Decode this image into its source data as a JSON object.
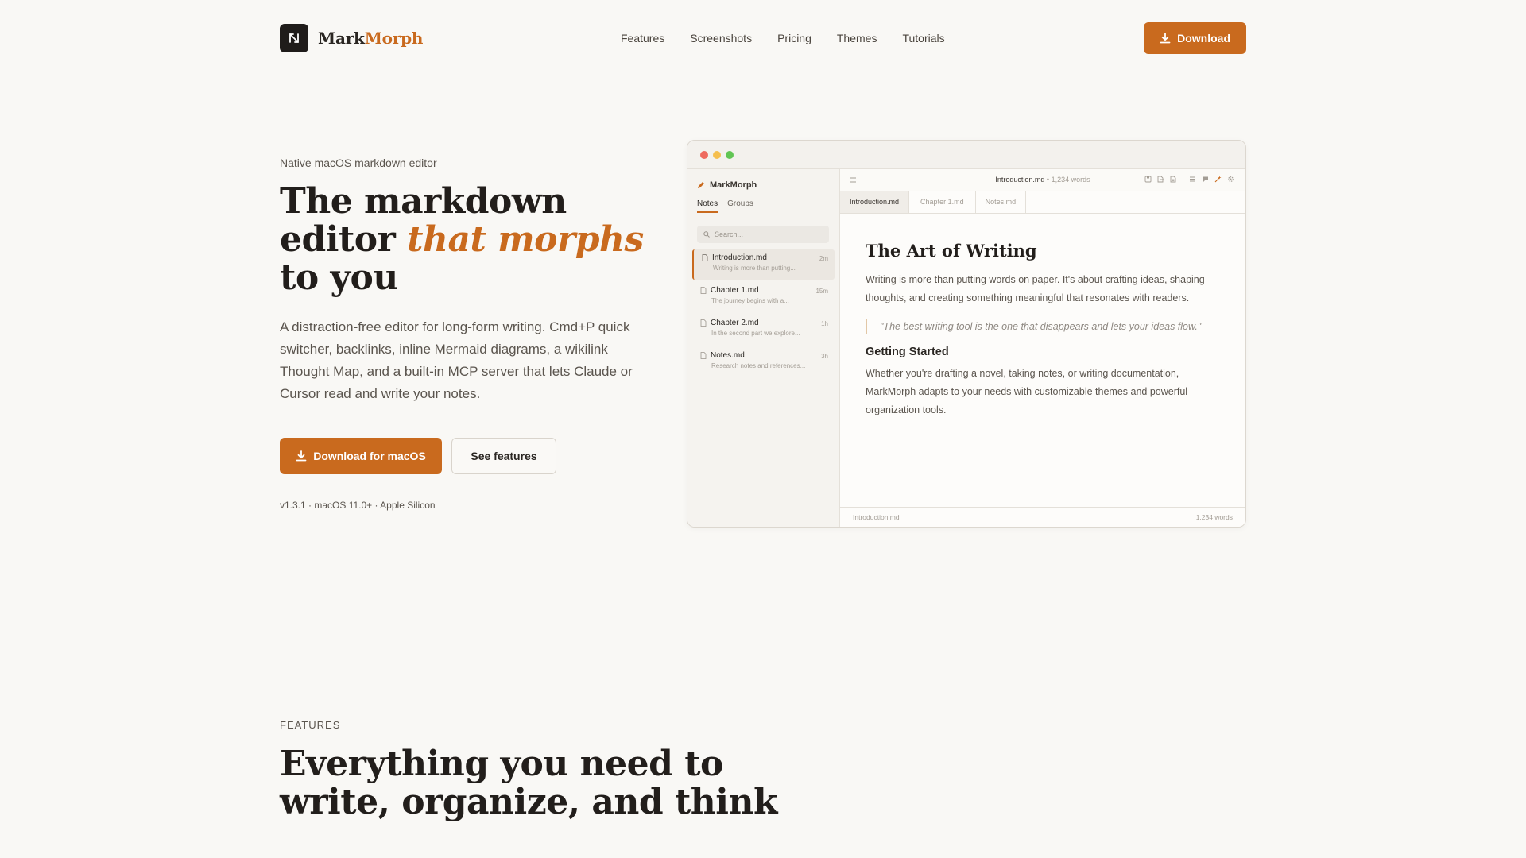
{
  "nav": {
    "brand_part1": "Mark",
    "brand_part2": "Morph",
    "links": [
      "Features",
      "Screenshots",
      "Pricing",
      "Themes",
      "Tutorials"
    ],
    "download_label": "Download"
  },
  "hero": {
    "eyebrow": "Native macOS markdown editor",
    "title_part1": "The markdown editor ",
    "title_accent": "that morphs",
    "title_part2": " to you",
    "description": "A distraction-free editor for long-form writing. Cmd+P quick switcher, backlinks, inline Mermaid diagrams, a wikilink Thought Map, and a built-in MCP server that lets Claude or Cursor read and write your notes.",
    "primary_cta": "Download for macOS",
    "secondary_cta": "See features",
    "version_info": "v1.3.1 · macOS 11.0+ · Apple Silicon"
  },
  "app": {
    "brand": "MarkMorph",
    "sidebar_tabs": [
      "Notes",
      "Groups"
    ],
    "search_placeholder": "Search...",
    "files": [
      {
        "name": "Introduction.md",
        "preview": "Writing is more than putting...",
        "time": "2m",
        "active": true
      },
      {
        "name": "Chapter 1.md",
        "preview": "The journey begins with a...",
        "time": "15m",
        "active": false
      },
      {
        "name": "Chapter 2.md",
        "preview": "In the second part we explore...",
        "time": "1h",
        "active": false
      },
      {
        "name": "Notes.md",
        "preview": "Research notes and references...",
        "time": "3h",
        "active": false
      }
    ],
    "toolbar_filename": "Introduction.md",
    "toolbar_separator": "•",
    "toolbar_wordcount": "1,234 words",
    "tabs": [
      "Introduction.md",
      "Chapter 1.md",
      "Notes.md"
    ],
    "doc": {
      "heading": "The Art of Writing",
      "para1": "Writing is more than putting words on paper. It's about crafting ideas, shaping thoughts, and creating something meaningful that resonates with readers.",
      "quote": "\"The best writing tool is the one that disappears and lets your ideas flow.\"",
      "subheading": "Getting Started",
      "para2": "Whether you're drafting a novel, taking notes, or writing documentation, MarkMorph adapts to your needs with customizable themes and powerful organization tools."
    },
    "status_left": "Introduction.md",
    "status_right": "1,234 words"
  },
  "features": {
    "label": "FEATURES",
    "title": "Everything you need to write, organize, and think"
  },
  "colors": {
    "accent": "#c96a1e",
    "background": "#f9f8f5",
    "text": "#221e1b",
    "traffic_red": "#ee6a5f",
    "traffic_yellow": "#f5bf4f",
    "traffic_green": "#61c554"
  },
  "icons": [
    "logo-icon",
    "download-icon",
    "pencil-icon",
    "search-icon",
    "file-icon",
    "menu-icon",
    "save-icon",
    "export-icon",
    "print-icon",
    "list-icon",
    "comment-icon",
    "magic-icon",
    "settings-icon"
  ]
}
